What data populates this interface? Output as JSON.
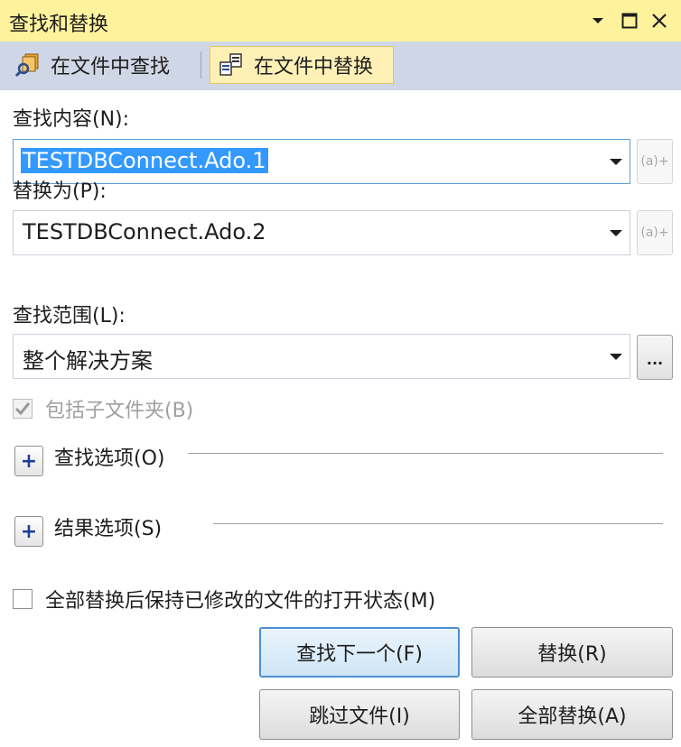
{
  "window": {
    "title": "查找和替换"
  },
  "tabs": {
    "find_in_files": "在文件中查找",
    "replace_in_files": "在文件中替换"
  },
  "find": {
    "label": "查找内容(N):",
    "value": "TESTDBConnect.Ado.1",
    "regex_button": "(a)+"
  },
  "replace": {
    "label": "替换为(P):",
    "value": "TESTDBConnect.Ado.2",
    "regex_button": "(a)+"
  },
  "scope": {
    "label": "查找范围(L):",
    "value": "整个解决方案",
    "browse_button": "..."
  },
  "include_subfolders": {
    "label": "包括子文件夹(B)",
    "checked": true,
    "disabled": true
  },
  "find_options": {
    "toggle": "+",
    "label": "查找选项(O)"
  },
  "result_options": {
    "toggle": "+",
    "label": "结果选项(S)"
  },
  "keep_open": {
    "label": "全部替换后保持已修改的文件的打开状态(M)",
    "checked": false
  },
  "buttons": {
    "find_next": "查找下一个(F)",
    "replace": "替换(R)",
    "skip_file": "跳过文件(I)",
    "replace_all": "全部替换(A)"
  },
  "colors": {
    "titlebar": "#fff29d",
    "tabbar": "#cfd6e5",
    "active_tab": "#fff0b6",
    "selection": "#3399ff",
    "default_button_border": "#4e8fcf"
  },
  "icons": {
    "find_in_files": "find-in-files-icon",
    "replace_in_files": "replace-in-files-icon",
    "pin": "pin-dropdown-icon",
    "maximize": "maximize-icon",
    "close": "close-icon"
  }
}
